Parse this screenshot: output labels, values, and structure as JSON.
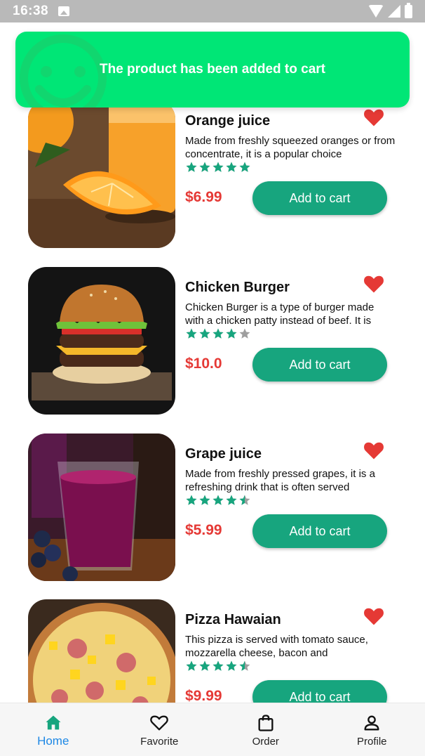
{
  "status_bar": {
    "time": "16:38"
  },
  "toast": {
    "message": "The product has been added to cart",
    "color": "#00e676"
  },
  "colors": {
    "accent": "#17a57e",
    "price": "#e53935",
    "favorite": "#e53935",
    "nav_active": "#1e88e5"
  },
  "products": [
    {
      "name": "Orange juice",
      "description": "Made from freshly squeezed oranges or from concentrate, it is a popular choice",
      "price": "$6.99",
      "rating": 5,
      "favorite": true,
      "button_label": "Add to cart"
    },
    {
      "name": "Chicken Burger",
      "description": "Chicken Burger is a type of burger made with a chicken patty instead of beef. It is",
      "price": "$10.0",
      "rating": 4,
      "favorite": true,
      "button_label": "Add to cart"
    },
    {
      "name": "Grape juice",
      "description": "Made from freshly pressed grapes, it is a refreshing drink that is often served",
      "price": "$5.99",
      "rating": 4.5,
      "favorite": true,
      "button_label": "Add to cart"
    },
    {
      "name": "Pizza Hawaian",
      "description": "This pizza is served with tomato sauce, mozzarella cheese, bacon and",
      "price": "$9.99",
      "rating": 4.5,
      "favorite": true,
      "button_label": "Add to cart"
    }
  ],
  "bottom_nav": [
    {
      "label": "Home",
      "icon": "home-icon",
      "active": true
    },
    {
      "label": "Favorite",
      "icon": "heart-outline-icon",
      "active": false
    },
    {
      "label": "Order",
      "icon": "shopping-bag-icon",
      "active": false
    },
    {
      "label": "Profile",
      "icon": "person-icon",
      "active": false
    }
  ]
}
